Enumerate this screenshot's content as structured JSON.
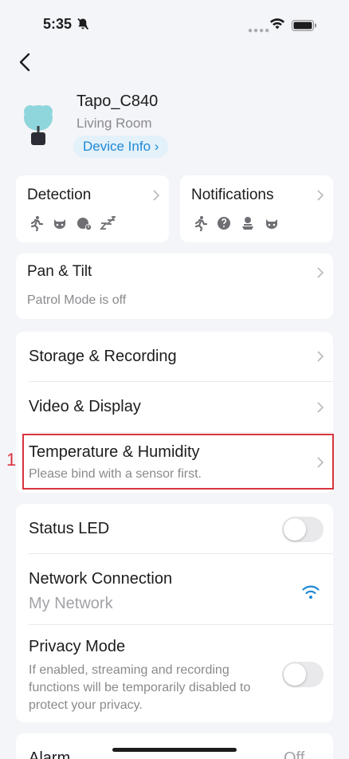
{
  "status_bar": {
    "time": "5:35"
  },
  "device": {
    "name": "Tapo_C840",
    "room": "Living Room",
    "info_button": "Device Info"
  },
  "detection_card": {
    "title": "Detection",
    "icons": [
      "person-running-icon",
      "pet-icon",
      "baby-cry-icon",
      "sleep-icon"
    ]
  },
  "notifications_card": {
    "title": "Notifications",
    "icons": [
      "person-running-icon",
      "sound-icon",
      "package-icon",
      "pet-icon"
    ]
  },
  "pan_tilt": {
    "title": "Pan & Tilt",
    "status": "Patrol Mode is off"
  },
  "settings_group": {
    "storage": "Storage & Recording",
    "video": "Video & Display",
    "temperature_title": "Temperature & Humidity",
    "temperature_sub": "Please bind with a sensor first."
  },
  "annotation_marker": "1",
  "toggles_group": {
    "status_led": "Status LED",
    "network_title": "Network Connection",
    "network_value": "My Network",
    "privacy_title": "Privacy Mode",
    "privacy_desc": "If enabled, streaming and recording functions will be temporarily disabled to protect your privacy."
  },
  "alarm": {
    "title": "Alarm",
    "value": "Off"
  },
  "colors": {
    "accent": "#1e88d5",
    "highlight": "#d9333f",
    "background": "#f4f5f8"
  }
}
